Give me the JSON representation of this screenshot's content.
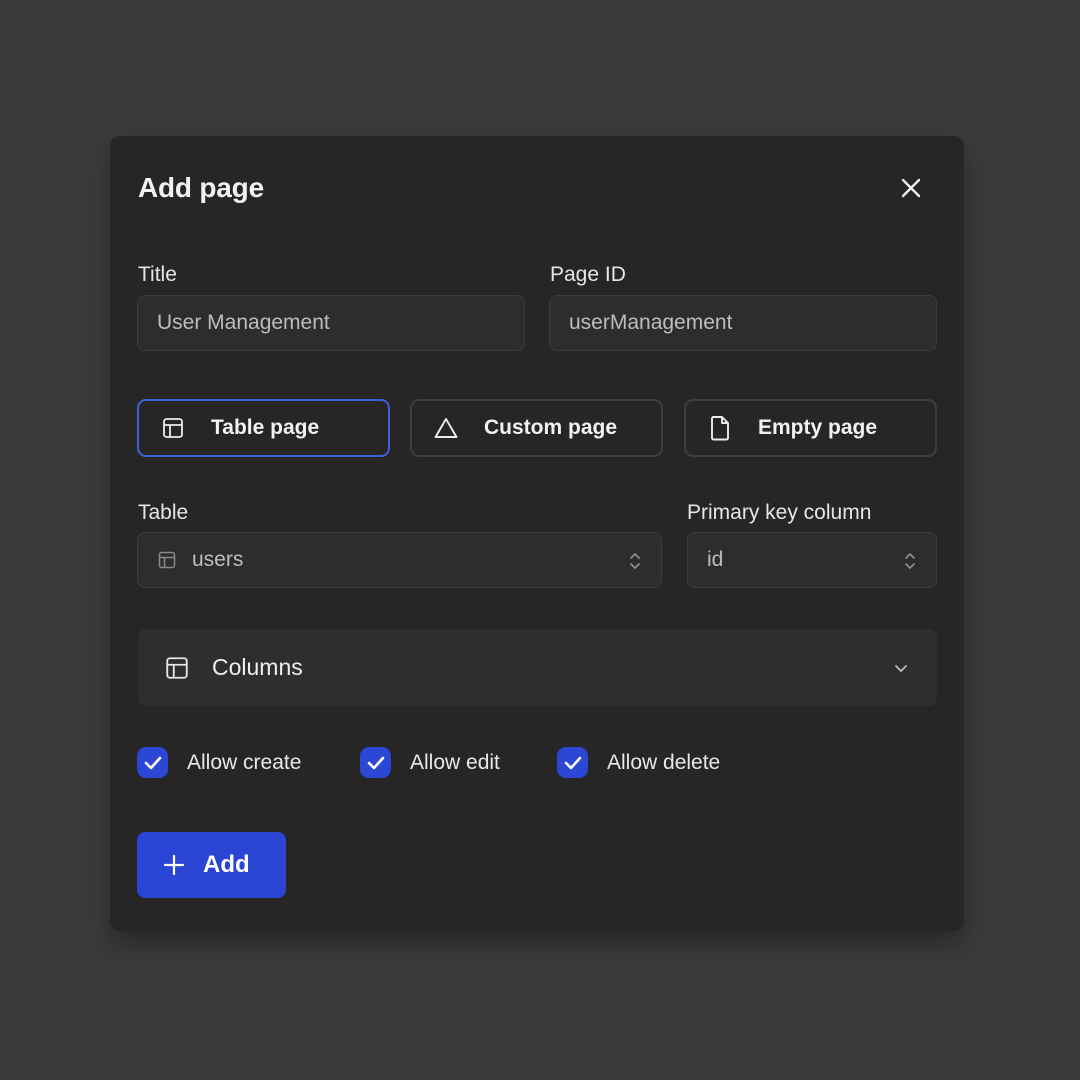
{
  "modal": {
    "title": "Add page"
  },
  "icons": {
    "close": "close-icon",
    "table": "table-icon",
    "triangle": "triangle-icon",
    "file": "file-icon",
    "updown": "chevron-up-down-icon",
    "chevron_down": "chevron-down-icon",
    "check": "check-icon",
    "plus": "plus-icon"
  },
  "fields": {
    "title": {
      "label": "Title",
      "value": "User Management"
    },
    "page_id": {
      "label": "Page ID",
      "value": "userManagement"
    }
  },
  "page_types": [
    {
      "label": "Table page",
      "icon": "table-icon",
      "selected": true
    },
    {
      "label": "Custom page",
      "icon": "triangle-icon",
      "selected": false
    },
    {
      "label": "Empty page",
      "icon": "file-icon",
      "selected": false
    }
  ],
  "table_select": {
    "label": "Table",
    "value": "users"
  },
  "primary_key_select": {
    "label": "Primary key column",
    "value": "id"
  },
  "columns_section": {
    "label": "Columns",
    "expanded": false
  },
  "permissions": [
    {
      "label": "Allow create",
      "checked": true
    },
    {
      "label": "Allow edit",
      "checked": true
    },
    {
      "label": "Allow delete",
      "checked": true
    }
  ],
  "add_button": {
    "label": "Add"
  },
  "colors": {
    "background": "#3a3a3a",
    "modal": "#262626",
    "accent": "#2a44d4",
    "selected_border": "#3f5fd8"
  }
}
